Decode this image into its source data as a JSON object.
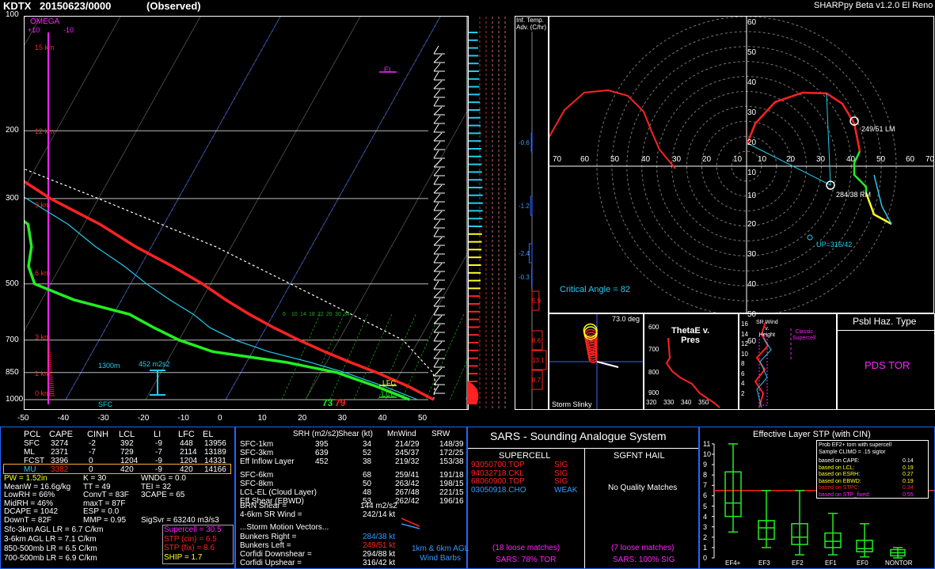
{
  "header": {
    "station": "KDTX",
    "date": "20150623/0000",
    "status": "(Observed)",
    "app": "SHARPpy Beta v1.2.0 El Reno"
  },
  "colors": {
    "temp": "#ff2222",
    "dewp": "#22ee22",
    "wetbulb": "#22ccee",
    "magenta": "#ff22ff",
    "cyan": "#22ccee",
    "yellow": "#ffff22",
    "green": "#22ee22",
    "red": "#ff2222",
    "blue": "#3366ff",
    "gray": "#888888"
  },
  "skewt": {
    "pressure_labels": [
      "100",
      "200",
      "300",
      "500",
      "700",
      "850",
      "1000"
    ],
    "temp_labels": [
      "-50",
      "-40",
      "-30",
      "-20",
      "-10",
      "0",
      "10",
      "20",
      "30",
      "40",
      "50"
    ],
    "height_labels": [
      "15 km",
      "12 km",
      "9 km",
      "6 km",
      "3 km",
      "1 km",
      "0 km"
    ],
    "omega_title": "OMEGA",
    "omega_left": "+10",
    "omega_right": "-10",
    "mix_labels": [
      "6",
      "10",
      "14",
      "18",
      "22",
      "26",
      "30",
      "34"
    ],
    "el": "EL",
    "lfc": "LFC",
    "lcl": "LCL",
    "sfc": "SFC",
    "eff_bottom": "1300m",
    "eff_srh": "452 m2s2",
    "sfc_dewp": "73",
    "sfc_temp": "79"
  },
  "chart_data": {
    "type": "line",
    "title": "KDTX 20150623/0000 (Observed)",
    "series": [
      {
        "name": "Temperature",
        "points": [
          [
            1000,
            26
          ],
          [
            925,
            22
          ],
          [
            850,
            17
          ],
          [
            800,
            13
          ],
          [
            750,
            9
          ],
          [
            700,
            5
          ],
          [
            650,
            1
          ],
          [
            600,
            -3
          ],
          [
            550,
            -7
          ],
          [
            500,
            -11
          ],
          [
            450,
            -16
          ],
          [
            400,
            -22
          ],
          [
            350,
            -28
          ],
          [
            300,
            -36
          ],
          [
            250,
            -44
          ],
          [
            200,
            -54
          ],
          [
            175,
            -57
          ],
          [
            150,
            -60
          ],
          [
            125,
            -55
          ],
          [
            110,
            -53
          ],
          [
            100,
            -52
          ]
        ]
      },
      {
        "name": "Dewpoint",
        "points": [
          [
            1000,
            23
          ],
          [
            925,
            18
          ],
          [
            850,
            12
          ],
          [
            800,
            5
          ],
          [
            750,
            -5
          ],
          [
            700,
            -10
          ],
          [
            650,
            -14
          ],
          [
            600,
            -18
          ],
          [
            550,
            -26
          ],
          [
            500,
            -32
          ],
          [
            450,
            -34
          ],
          [
            400,
            -35
          ],
          [
            350,
            -37
          ],
          [
            300,
            -43
          ],
          [
            250,
            -51
          ],
          [
            200,
            -62
          ],
          [
            150,
            -64
          ],
          [
            130,
            -60
          ],
          [
            120,
            -80
          ],
          [
            100,
            -84
          ]
        ]
      },
      {
        "name": "Wetbulb",
        "points": [
          [
            1000,
            24
          ],
          [
            925,
            19
          ],
          [
            850,
            13
          ],
          [
            800,
            8
          ],
          [
            750,
            2
          ],
          [
            700,
            -3
          ],
          [
            650,
            -7
          ],
          [
            600,
            -10
          ],
          [
            550,
            -14
          ],
          [
            500,
            -18
          ],
          [
            450,
            -22
          ],
          [
            400,
            -27
          ],
          [
            350,
            -32
          ],
          [
            300,
            -39
          ],
          [
            250,
            -47
          ]
        ]
      },
      {
        "name": "Parcel",
        "points": [
          [
            1000,
            26
          ],
          [
            900,
            25
          ],
          [
            850,
            24
          ],
          [
            700,
            18
          ],
          [
            500,
            0
          ],
          [
            400,
            -12
          ],
          [
            300,
            -30
          ],
          [
            200,
            -56
          ],
          [
            150,
            -66
          ],
          [
            100,
            -78
          ]
        ]
      }
    ],
    "xlim": [
      -50,
      50
    ],
    "ylim": [
      1000,
      100
    ],
    "yscale": "log",
    "hodograph": {
      "rings": [
        "10",
        "20",
        "30",
        "40",
        "50",
        "60",
        "70"
      ],
      "points": [
        [
          38,
          252
        ],
        [
          30,
          240
        ],
        [
          10,
          225
        ],
        [
          5,
          205
        ],
        [
          6,
          190
        ],
        [
          10,
          185
        ],
        [
          20,
          190
        ],
        [
          40,
          200
        ],
        [
          52,
          205
        ],
        [
          60,
          210
        ],
        [
          65,
          212
        ],
        [
          60,
          220
        ],
        [
          55,
          225
        ]
      ]
    }
  },
  "hodo": {
    "x_labels": [
      "70",
      "60",
      "50",
      "40",
      "30",
      "20",
      "10",
      "10",
      "20",
      "30",
      "40",
      "50",
      "60",
      "70"
    ],
    "y_labels": [
      "60",
      "50",
      "40",
      "30",
      "20",
      "10",
      "10",
      "20",
      "30",
      "40",
      "50",
      "60"
    ],
    "lm": "249/51 LM",
    "rm": "284/38 RM",
    "up": "UP=316/42",
    "critical": "Critical Angle = 82"
  },
  "adv": {
    "title": "Inf. Temp.\nAdv. (C/hr)",
    "values": [
      "-0.6",
      "-1.2",
      "-2.4",
      "-0.3",
      "5.9",
      "8.6",
      "13.1",
      "8.7"
    ]
  },
  "slinky": {
    "angle": "73.0 deg",
    "label": "Storm Slinky"
  },
  "thetae": {
    "title": "ThetaE v.\nPres",
    "y": [
      "600",
      "700",
      "800",
      "900"
    ],
    "x": [
      "320",
      "330",
      "340",
      "350"
    ]
  },
  "srwind": {
    "title": "SR Wind\nv.\nHeight",
    "classic": "Classic\nSupercell",
    "y": [
      "16",
      "14",
      "12",
      "10",
      "8",
      "6",
      "4",
      "2"
    ]
  },
  "haz": {
    "title": "Psbl Haz. Type",
    "type": "PDS TOR"
  },
  "thermo": {
    "cols": [
      "PCL",
      "CAPE",
      "CINH",
      "LCL",
      "LI",
      "LFC",
      "EL"
    ],
    "rows": [
      [
        "SFC",
        "3274",
        "-2",
        "392",
        "-9",
        "448",
        "13956"
      ],
      [
        "ML",
        "2371",
        "-7",
        "729",
        "-7",
        "2114",
        "13189"
      ],
      [
        "FCST",
        "3396",
        "0",
        "1204",
        "-9",
        "1204",
        "14331"
      ],
      [
        "MU",
        "3382",
        "0",
        "420",
        "-9",
        "420",
        "14166"
      ]
    ],
    "misc_a": [
      "PW = 1.52in",
      "MeanW = 16.6g/kg",
      "LowRH = 66%",
      "MidRH = 46%",
      "DCAPE = 1042",
      "DownT = 82F"
    ],
    "misc_b": [
      "K = 30",
      "TT = 49",
      "ConvT = 83F",
      "maxT = 87F",
      "ESP = 0.0",
      "MMP = 0.95"
    ],
    "misc_c": [
      "WNDG = 0.0",
      "TEI = 32",
      "3CAPE = 65",
      "",
      "",
      "SigSvr = 63240 m3/s3"
    ],
    "lapse": [
      "Sfc-3km AGL LR = 6.7 C/km",
      "3-6km AGL LR = 7.1 C/km",
      "850-500mb LR = 6.5 C/km",
      "700-500mb LR = 6.9 C/km"
    ],
    "idx": [
      "Supercell = 30.5",
      "STP (cin) = 6.5",
      "STP (fix) = 8.6",
      "SHIP = 1.7"
    ]
  },
  "kin": {
    "cols": [
      "SRH (m2/s2)",
      "Shear (kt)",
      "MnWind",
      "SRW"
    ],
    "rows": [
      [
        "SFC-1km",
        "395",
        "34",
        "214/29",
        "148/39"
      ],
      [
        "SFC-3km",
        "639",
        "52",
        "245/37",
        "172/25"
      ],
      [
        "Eff Inflow Layer",
        "452",
        "38",
        "219/32",
        "153/38"
      ],
      [
        "SFC-6km",
        "",
        "68",
        "259/41",
        "191/18"
      ],
      [
        "SFC-8km",
        "",
        "50",
        "263/42",
        "198/15"
      ],
      [
        "LCL-EL (Cloud Layer)",
        "",
        "48",
        "267/48",
        "221/15"
      ],
      [
        "Eff Shear (EBWD)",
        "",
        "53",
        "262/42",
        "196/16"
      ]
    ],
    "brn_shear": "BRN Shear =",
    "brn_shear_v": "144 m2/s2",
    "sr_wind": "4-6km SR Wind =",
    "sr_wind_v": "242/14 kt",
    "motion_title": "...Storm Motion Vectors...",
    "motion": [
      [
        "Bunkers Right =",
        "284/38 kt"
      ],
      [
        "Bunkers Left =",
        "249/51 kt"
      ],
      [
        "Corfidi Downshear =",
        "294/88 kt"
      ],
      [
        "Corfidi Upshear =",
        "316/42 kt"
      ]
    ],
    "barbs": "1km & 6km AGL\nWind Barbs"
  },
  "sars": {
    "title": "SARS - Sounding Analogue System",
    "supercell": "SUPERCELL",
    "hail": "SGFNT HAIL",
    "matches": [
      [
        "93050700.TOP",
        "SIG"
      ],
      [
        "94032718.CKL",
        "SIG"
      ],
      [
        "68060900.TOP",
        "SIG"
      ],
      [
        "03050918.CHO",
        "WEAK"
      ]
    ],
    "no_match": "No Quality Matches",
    "loose_l": "(18 loose matches)",
    "loose_r": "(7 loose matches)",
    "pct_l": "SARS: 78% TOR",
    "pct_r": "SARS: 100% SIG"
  },
  "stp": {
    "title": "Effective Layer STP (with CIN)",
    "y": [
      "11",
      "10",
      "9",
      "8",
      "7",
      "6",
      "5",
      "4",
      "3",
      "2",
      "1",
      "0"
    ],
    "cats": [
      "EF4+",
      "EF3",
      "EF2",
      "EF1",
      "EF0",
      "NONTOR"
    ],
    "box_stats": [
      [
        2.5,
        4,
        5.3,
        8.3,
        11
      ],
      [
        1,
        1.8,
        2.9,
        3.6,
        6.5
      ],
      [
        0.3,
        1.3,
        2,
        3.3,
        6.5
      ],
      [
        0.3,
        1,
        1.6,
        2.4,
        4.3
      ],
      [
        0.1,
        0.6,
        0.9,
        1.7,
        3.3
      ],
      [
        0,
        0.2,
        0.5,
        0.8,
        1
      ]
    ],
    "prob_title": "Prob EF2+ torn with supercell",
    "prob_sub": "Sample CLIMO = .15 sigtor",
    "prob": [
      [
        "based on CAPE:",
        "0.14"
      ],
      [
        "based on LCL:",
        "0.19"
      ],
      [
        "based on ESRH:",
        "0.27"
      ],
      [
        "based on EBWD:",
        "0.19"
      ],
      [
        "based on STPC:",
        "0.34"
      ],
      [
        "based on STP_fixed:",
        "0.55"
      ]
    ]
  }
}
